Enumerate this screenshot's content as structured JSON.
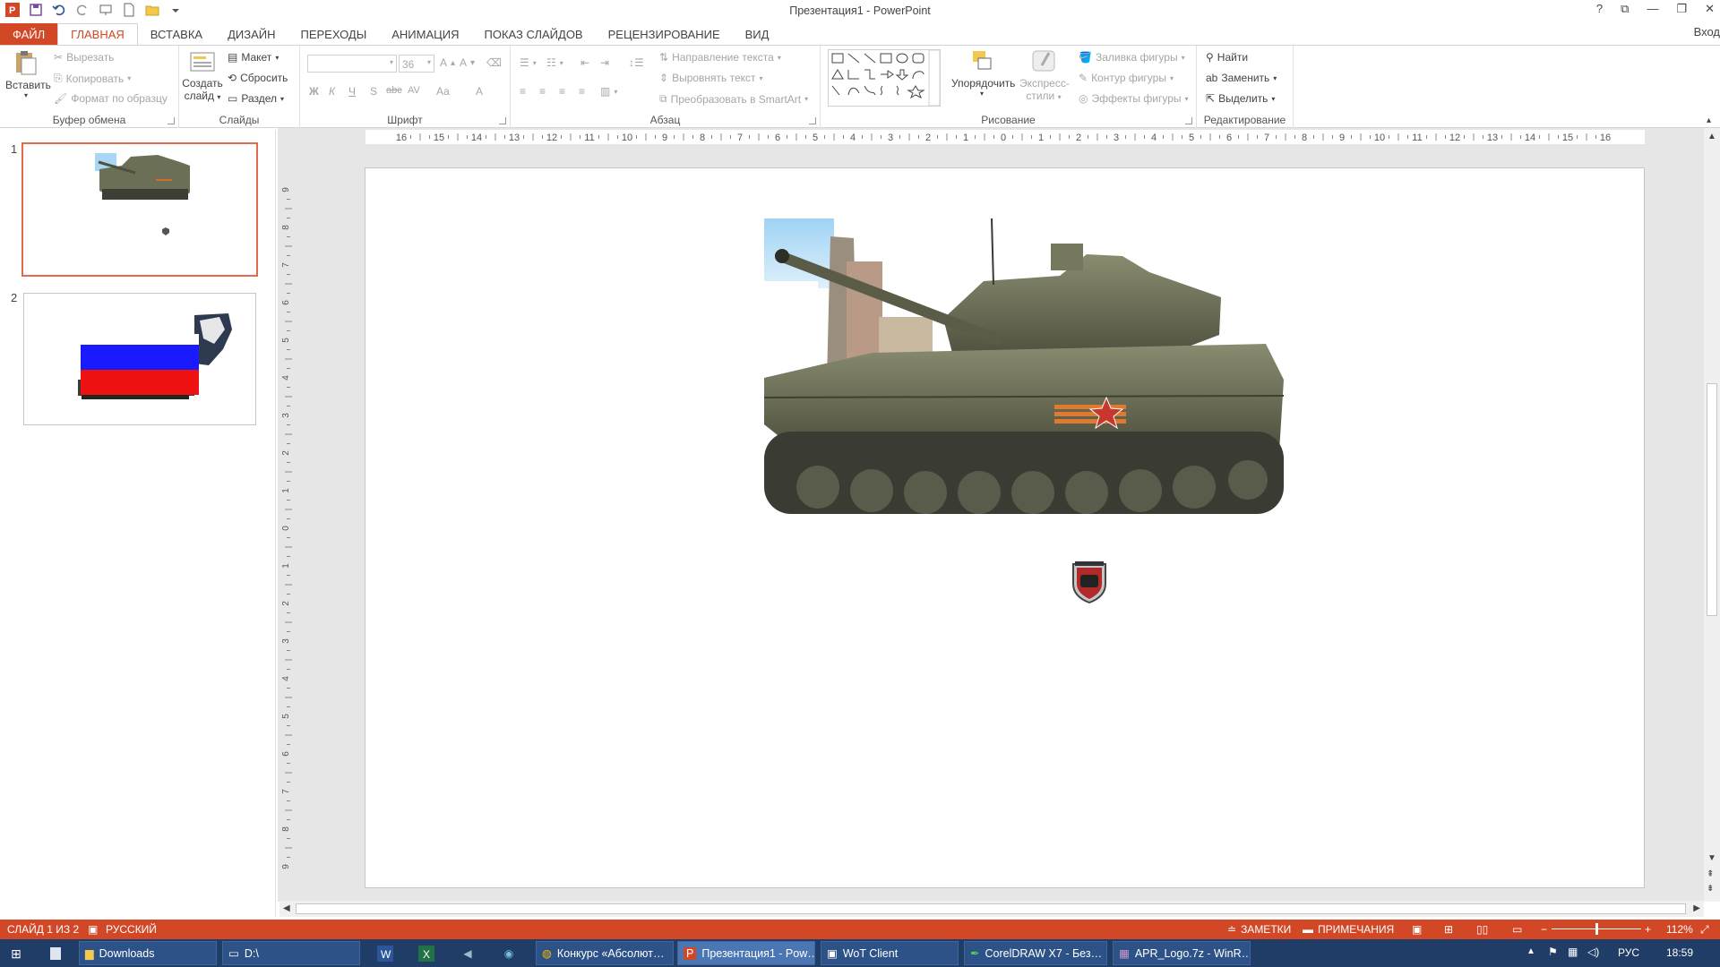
{
  "app": {
    "title": "Презентация1 - PowerPoint",
    "signin": "Вход",
    "window_controls": [
      "?",
      "⧉",
      "—",
      "❐",
      "✕"
    ]
  },
  "quick_access": [
    "powerpoint-logo-icon",
    "save-icon",
    "undo-icon",
    "redo-icon",
    "present-icon",
    "new-icon",
    "open-icon",
    "customize-icon"
  ],
  "tabs": [
    "ФАЙЛ",
    "ГЛАВНАЯ",
    "ВСТАВКА",
    "ДИЗАЙН",
    "ПЕРЕХОДЫ",
    "АНИМАЦИЯ",
    "ПОКАЗ СЛАЙДОВ",
    "РЕЦЕНЗИРОВАНИЕ",
    "ВИД"
  ],
  "active_tab": "ГЛАВНАЯ",
  "ribbon": {
    "clipboard": {
      "caption": "Буфер обмена",
      "paste": "Вставить",
      "cut": "Вырезать",
      "copy": "Копировать",
      "format_painter": "Формат по образцу"
    },
    "slides": {
      "caption": "Слайды",
      "new_slide_1": "Создать",
      "new_slide_2": "слайд",
      "layout": "Макет",
      "reset": "Сбросить",
      "section": "Раздел"
    },
    "font": {
      "caption": "Шрифт",
      "font_name": "",
      "font_size": "36",
      "bold": "Ж",
      "italic": "К",
      "underline": "Ч",
      "shadow": "S",
      "strike": "abc",
      "spacing": "AV",
      "case": "Аа",
      "color": "A"
    },
    "paragraph": {
      "caption": "Абзац",
      "text_direction": "Направление текста",
      "align_text": "Выровнять текст",
      "smartart": "Преобразовать в SmartArt"
    },
    "drawing": {
      "caption": "Рисование",
      "arrange": "Упорядочить",
      "quick_styles_1": "Экспресс-",
      "quick_styles_2": "стили",
      "shape_fill": "Заливка фигуры",
      "shape_outline": "Контур фигуры",
      "shape_effects": "Эффекты фигуры"
    },
    "editing": {
      "caption": "Редактирование",
      "find": "Найти",
      "replace": "Заменить",
      "select": "Выделить"
    }
  },
  "slides_panel": [
    {
      "number": "1",
      "selected": true
    },
    {
      "number": "2",
      "selected": false
    }
  ],
  "ruler": {
    "h_ticks": [
      "16",
      "15",
      "14",
      "13",
      "12",
      "11",
      "10",
      "9",
      "8",
      "7",
      "6",
      "5",
      "4",
      "3",
      "2",
      "1",
      "0",
      "1",
      "2",
      "3",
      "4",
      "5",
      "6",
      "7",
      "8",
      "9",
      "10",
      "11",
      "12",
      "13",
      "14",
      "15",
      "16"
    ],
    "v_ticks": [
      "9",
      "8",
      "7",
      "6",
      "5",
      "4",
      "3",
      "2",
      "1",
      "0",
      "1",
      "2",
      "3",
      "4",
      "5",
      "6",
      "7",
      "8",
      "9"
    ]
  },
  "statusbar": {
    "slide_info": "СЛАЙД 1 ИЗ 2",
    "language": "РУССКИЙ",
    "notes": "ЗАМЕТКИ",
    "comments": "ПРИМЕЧАНИЯ",
    "zoom": "112%"
  },
  "taskbar": {
    "items": [
      "Downloads",
      "D:\\",
      "Конкурс «Абсолют…",
      "Презентация1 - Pow…",
      "WoT Client",
      "CorelDRAW X7 - Без…",
      "APR_Logo.7z - WinR…"
    ],
    "language": "РУС",
    "time": "18:59"
  },
  "colors": {
    "accent": "#d24726",
    "taskbar": "#1f3d66",
    "flag_white": "#ffffff",
    "flag_blue": "#1a1aff",
    "flag_red": "#ee1111"
  }
}
